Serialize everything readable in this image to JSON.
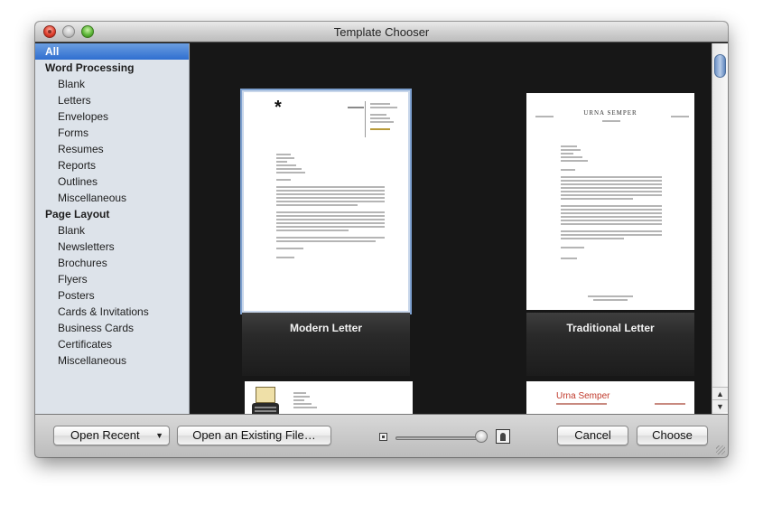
{
  "window": {
    "title": "Template Chooser"
  },
  "sidebar": {
    "all": "All",
    "groups": [
      {
        "heading": "Word Processing",
        "items": [
          "Blank",
          "Letters",
          "Envelopes",
          "Forms",
          "Resumes",
          "Reports",
          "Outlines",
          "Miscellaneous"
        ]
      },
      {
        "heading": "Page Layout",
        "items": [
          "Blank",
          "Newsletters",
          "Brochures",
          "Flyers",
          "Posters",
          "Cards & Invitations",
          "Business Cards",
          "Certificates",
          "Miscellaneous"
        ]
      }
    ]
  },
  "templates": [
    {
      "name": "Modern Letter",
      "selected": true
    },
    {
      "name": "Traditional Letter",
      "selected": false
    }
  ],
  "previews": {
    "traditional_name": "URNA SEMPER",
    "resume_name": "Urna Semper",
    "modern_mark": "*"
  },
  "bottom": {
    "open_recent": "Open Recent",
    "open_existing": "Open an Existing File…",
    "cancel": "Cancel",
    "choose": "Choose",
    "zoom_level": 0.95
  },
  "colors": {
    "selection": "#2f6ed0",
    "sidebar_bg": "#dde3ea",
    "gallery_bg": "#171717",
    "resume_accent": "#c0392b"
  }
}
